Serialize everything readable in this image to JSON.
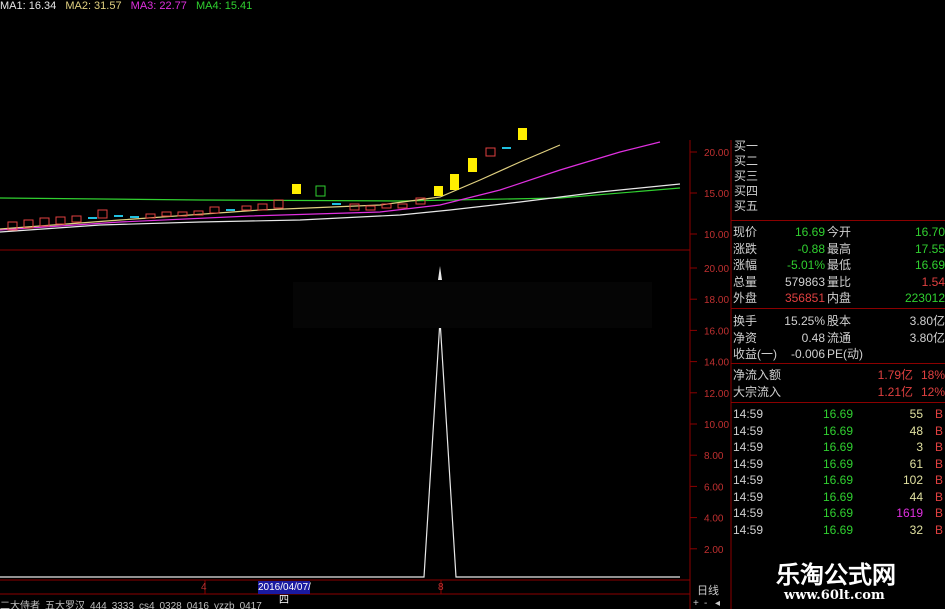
{
  "indicators": [
    {
      "label": "MA1: 16.34",
      "color": "#e8e8e8"
    },
    {
      "label": "MA2: 31.57",
      "color": "#e0d080"
    },
    {
      "label": "MA3: 22.77",
      "color": "#e030e0"
    },
    {
      "label": "MA4: 15.41",
      "color": "#30d030"
    }
  ],
  "price_axis": [
    "20.00",
    "15.00",
    "10.00"
  ],
  "volume_axis": [
    "20.00",
    "18.00",
    "16.00",
    "14.00",
    "12.00",
    "10.00",
    "8.00",
    "6.00",
    "4.00",
    "2.00"
  ],
  "order_book": {
    "buy_labels": [
      "买一",
      "买二",
      "买三",
      "买四",
      "买五"
    ]
  },
  "quote": {
    "rows": [
      {
        "l1": "现价",
        "v1": "16.69",
        "c1": "#30d030",
        "l2": "今开",
        "v2": "16.70",
        "c2": "#30d030"
      },
      {
        "l1": "涨跌",
        "v1": "-0.88",
        "c1": "#30d030",
        "l2": "最高",
        "v2": "17.55",
        "c2": "#30d030"
      },
      {
        "l1": "涨幅",
        "v1": "-5.01%",
        "c1": "#30d030",
        "l2": "最低",
        "v2": "16.69",
        "c2": "#30d030"
      },
      {
        "l1": "总量",
        "v1": "579863",
        "c1": "#d0d0d0",
        "l2": "量比",
        "v2": "1.54",
        "c2": "#e04040"
      },
      {
        "l1": "外盘",
        "v1": "356851",
        "c1": "#e04040",
        "l2": "内盘",
        "v2": "223012",
        "c2": "#30d030"
      }
    ],
    "rows2": [
      {
        "l1": "换手",
        "v1": "15.25%",
        "l2": "股本",
        "v2": "3.80亿"
      },
      {
        "l1": "净资",
        "v1": "0.48",
        "l2": "流通",
        "v2": "3.80亿"
      },
      {
        "l1": "收益(一)",
        "v1": "-0.006",
        "l2": "PE(动)",
        "v2": ""
      }
    ],
    "flows": [
      {
        "label": "净流入额",
        "value": "1.79亿",
        "pct": "18%"
      },
      {
        "label": "大宗流入",
        "value": "1.21亿",
        "pct": "12%"
      }
    ]
  },
  "ticks": [
    {
      "time": "14:59",
      "price": "16.69",
      "vol": "55",
      "vcolor": "#e0e0a0",
      "side": "B"
    },
    {
      "time": "14:59",
      "price": "16.69",
      "vol": "48",
      "vcolor": "#e0e0a0",
      "side": "B"
    },
    {
      "time": "14:59",
      "price": "16.69",
      "vol": "3",
      "vcolor": "#e0e0a0",
      "side": "B"
    },
    {
      "time": "14:59",
      "price": "16.69",
      "vol": "61",
      "vcolor": "#e0e0a0",
      "side": "B"
    },
    {
      "time": "14:59",
      "price": "16.69",
      "vol": "102",
      "vcolor": "#e0e0a0",
      "side": "B"
    },
    {
      "time": "14:59",
      "price": "16.69",
      "vol": "44",
      "vcolor": "#e0e0a0",
      "side": "B"
    },
    {
      "time": "14:59",
      "price": "16.69",
      "vol": "1619",
      "vcolor": "#e030e0",
      "side": "B"
    },
    {
      "time": "14:59",
      "price": "16.69",
      "vol": "32",
      "vcolor": "#e0e0a0",
      "side": "B"
    }
  ],
  "date_label": "2016/04/07/四",
  "period_label": "日线",
  "cursor_marks": [
    "4",
    "8"
  ],
  "bottom_tabs": [
    "二大侍者",
    "五大罗汉",
    "444",
    "3333",
    "cs4",
    "0328",
    "0416",
    "yzzb",
    "0417"
  ],
  "watermark": {
    "title": "乐淘公式网",
    "url": "www.60lt.com"
  },
  "colors": {
    "up": "#e04040",
    "down": "#30d030",
    "grid": "#8b0000",
    "yellow": "#ffee00"
  }
}
